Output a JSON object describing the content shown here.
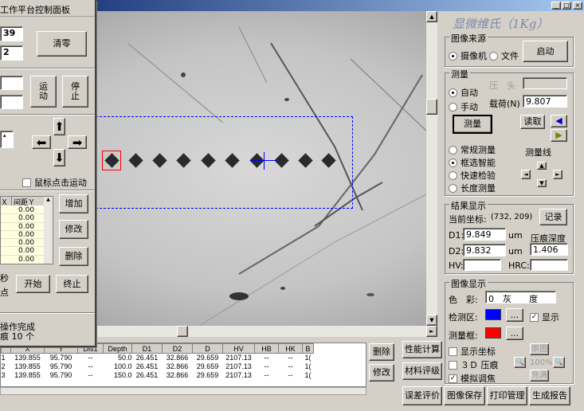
{
  "main_window": {
    "brand_title": "显微维氏（1Kg）",
    "title_buttons": [
      "_",
      "□",
      "×"
    ]
  },
  "image_source": {
    "title": "图像来源",
    "options": [
      "摄像机",
      "文件"
    ],
    "selected": "摄像机",
    "start_label": "启动"
  },
  "measure": {
    "title": "测量",
    "modes": [
      "自动",
      "手动"
    ],
    "selected_mode": "自动",
    "pressure_label": "压　头",
    "load_label": "载荷(N)",
    "load_value": "9.807",
    "measure_button": "测量",
    "read_button": "读取",
    "methods": [
      "常规测量",
      "框选智能",
      "快速检验",
      "长度测量"
    ],
    "selected_method": "框选智能",
    "measure_line_label": "测量线"
  },
  "results": {
    "title": "结果显示",
    "coord_label": "当前坐标:",
    "coord_value": "(732, 209)",
    "record_button": "记录",
    "d1_label": "D1:",
    "d1_value": "9.849",
    "d1_unit": "um",
    "d2_label": "D2:",
    "d2_value": "9.832",
    "d2_unit": "um",
    "depth_label": "压痕深度",
    "depth_value": "1.406",
    "hv_label": "HV:",
    "hrc_label": "HRC:"
  },
  "image_display": {
    "title": "图像显示",
    "color_label": "色　彩:",
    "color_value": "0　灰　　度",
    "detect_label": "检测区:",
    "detect_color": "#0000ff",
    "show_label": "显示",
    "frame_label": "测量框:",
    "frame_color": "#ff0000",
    "ellipsis": "...",
    "show_coord": "显示坐标",
    "press_3d": "３Ｄ 压痕",
    "fuzzy": "模拟调焦",
    "original": "原图",
    "zoom": "100%",
    "fill": "充满"
  },
  "bottom_buttons": [
    "误差评价",
    "图像保存",
    "打印管理",
    "生成报告"
  ],
  "table_side_buttons": [
    "删除",
    "修改"
  ],
  "table_action_buttons": [
    "性能计算",
    "材料评级"
  ],
  "results_table": {
    "headers": [
      "",
      "X",
      "Y",
      "Dis1",
      "Depth",
      "D1",
      "D2",
      "D",
      "HV",
      "HB",
      "HK",
      "B"
    ],
    "rows": [
      [
        "1",
        "139.855",
        "95.790",
        "--",
        "50.0",
        "26.451",
        "32.866",
        "29.659",
        "2107.13",
        "--",
        "--",
        "1("
      ],
      [
        "2",
        "139.855",
        "95.790",
        "--",
        "100.0",
        "26.451",
        "32.866",
        "29.659",
        "2107.13",
        "--",
        "--",
        "1("
      ],
      [
        "3",
        "139.855",
        "95.790",
        "--",
        "150.0",
        "26.451",
        "32.866",
        "29.659",
        "2107.13",
        "--",
        "--",
        "1("
      ]
    ]
  },
  "control_panel": {
    "title": "工作平台控制面板",
    "value_a": "39",
    "value_b": "2",
    "clear_button": "清零",
    "move_button": "运\n动",
    "stop_button": "停\n止",
    "mouse_move_label": "鼠标点击运动",
    "list_headers": [
      "Ｘ",
      "间距Ｙ"
    ],
    "list_values": [
      "0.00",
      "0.00",
      "0.00",
      "0.00",
      "0.00",
      "0.00",
      "0.00"
    ],
    "add_button": "增加",
    "edit_button": "修改",
    "delete_button": "删除",
    "seconds_label": "秒",
    "point_label": "点",
    "start_button": "开始",
    "end_button": "终止",
    "status_line1": "操作完成",
    "status_line2": "痕 10 个"
  }
}
